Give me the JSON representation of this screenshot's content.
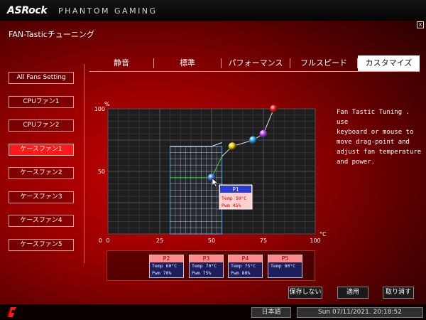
{
  "header": {
    "brand": "ASRock",
    "brand_sub": "PHANTOM GAMING",
    "close_label": "X"
  },
  "page": {
    "title": "FAN-Tasticチューニング"
  },
  "tabs": [
    {
      "label": "静音",
      "active": false
    },
    {
      "label": "標準",
      "active": false
    },
    {
      "label": "パフォーマンス",
      "active": false
    },
    {
      "label": "フルスピード",
      "active": false
    },
    {
      "label": "カスタマイズ",
      "active": true
    }
  ],
  "sidebar": {
    "items": [
      {
        "label": "All Fans Setting",
        "active": false
      },
      {
        "label": "CPUファン1",
        "active": false
      },
      {
        "label": "CPUファン2",
        "active": false
      },
      {
        "label": "ケースファン1",
        "active": true
      },
      {
        "label": "ケースファン2",
        "active": false
      },
      {
        "label": "ケースファン3",
        "active": false
      },
      {
        "label": "ケースファン4",
        "active": false
      },
      {
        "label": "ケースファン5",
        "active": false
      }
    ]
  },
  "chart_data": {
    "type": "line",
    "title": "",
    "xlabel": "°C",
    "ylabel": "%",
    "xlim": [
      0,
      100
    ],
    "ylim": [
      0,
      100
    ],
    "x_ticks": [
      0,
      25,
      50,
      75,
      100
    ],
    "y_ticks": [
      50,
      100
    ],
    "grid": true,
    "series": [
      {
        "points": [
          {
            "x": 50,
            "y": 45
          },
          {
            "x": 60,
            "y": 70
          },
          {
            "x": 70,
            "y": 75
          },
          {
            "x": 75,
            "y": 80
          },
          {
            "x": 80,
            "y": 100
          }
        ],
        "colors": [
          "#3d7bff",
          "#f0d000",
          "#1ea6ff",
          "#c040ff",
          "#ff1010"
        ]
      }
    ],
    "tooltip": {
      "title": "P1",
      "temp": "Temp 50°C",
      "pwm": "Pwm  45%"
    }
  },
  "help": {
    "text": "Fan Tastic Tuning . use\nkeyboard or mouse to\nmove drag-point and\nadjust fan temperature\nand power."
  },
  "points": [
    {
      "name": "P2",
      "temp": "Temp 60°C",
      "pwm": "Pwm  70%"
    },
    {
      "name": "P3",
      "temp": "Temp 70°C",
      "pwm": "Pwm  75%"
    },
    {
      "name": "P4",
      "temp": "Temp 75°C",
      "pwm": "Pwm  80%"
    },
    {
      "name": "P5",
      "temp": "Temp 80°C",
      "pwm": ""
    }
  ],
  "buttons": {
    "save": "保存しない",
    "apply": "適用",
    "cancel": "取り消す"
  },
  "footer": {
    "language": "日本語",
    "datetime": "Sun 07/11/2021. 20:18:52"
  },
  "colors": {
    "accent": "#ff1a1a",
    "grid_bg": "#1e1e1e",
    "select_box": "#5aa8e6"
  }
}
